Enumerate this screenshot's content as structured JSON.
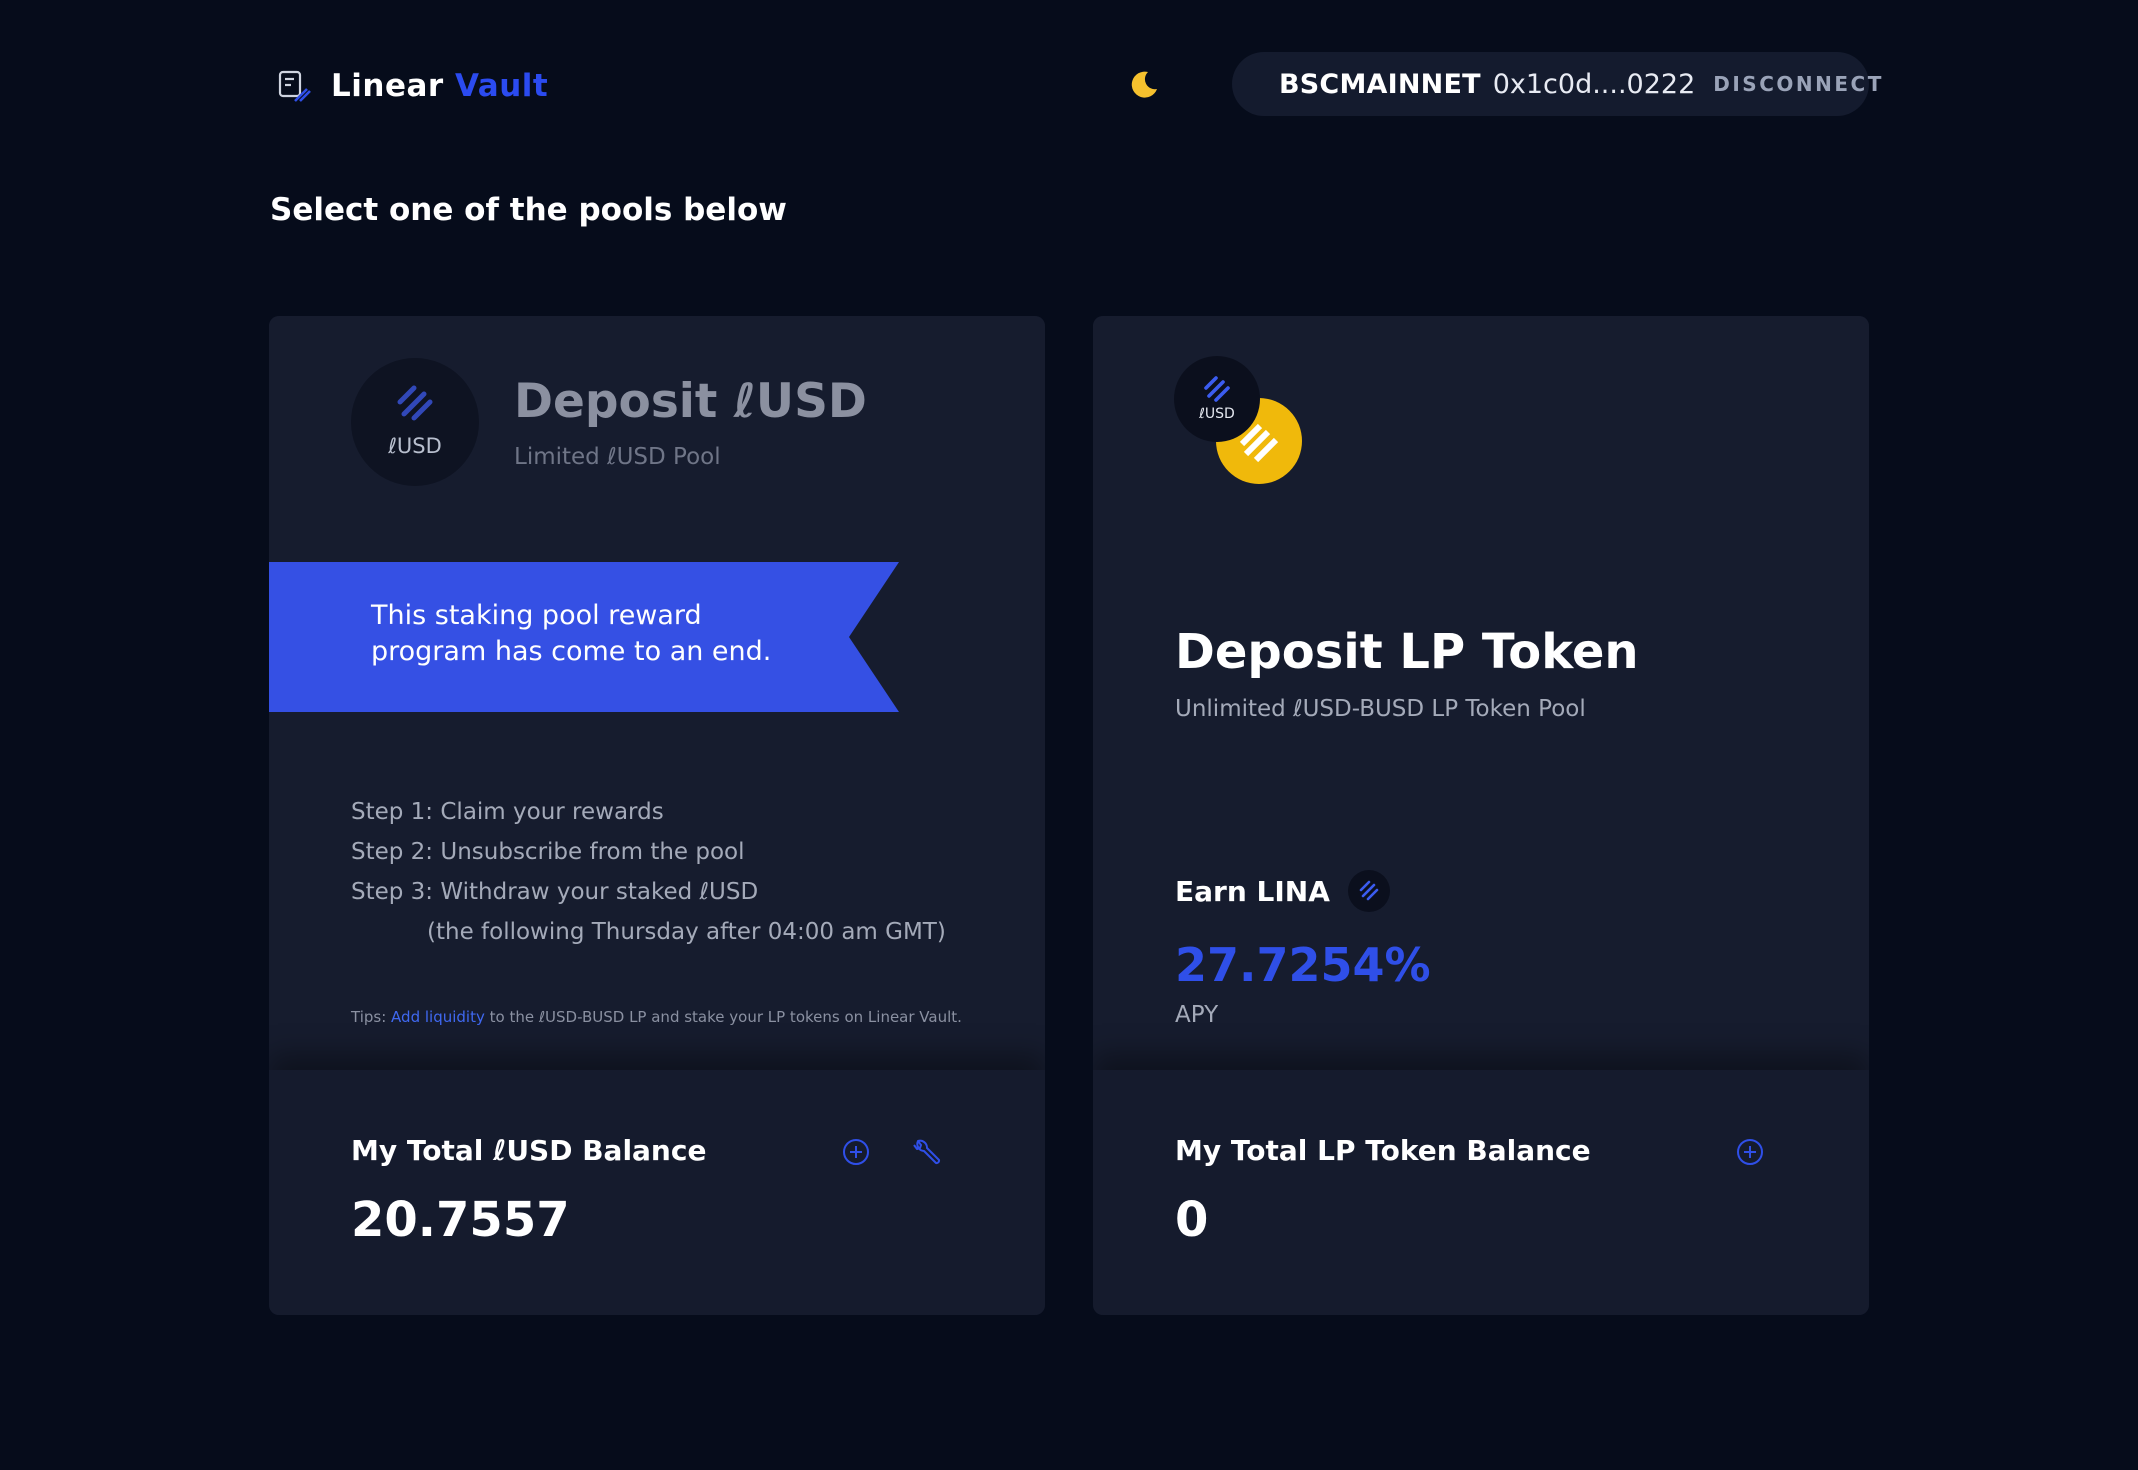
{
  "header": {
    "logo_word_1": "Linear",
    "logo_word_2": "Vault",
    "network": "BSCMAINNET",
    "address": "0x1c0d....0222",
    "disconnect_label": "DISCONNECT"
  },
  "page_title": "Select one of the pools below",
  "left_card": {
    "coin_label": "ℓUSD",
    "title": "Deposit ℓUSD",
    "subtitle": "Limited ℓUSD Pool",
    "ribbon_text": "This staking pool reward program has come to an end.",
    "steps": [
      "Step 1: Claim your rewards",
      "Step 2: Unsubscribe from the pool",
      "Step 3: Withdraw your staked ℓUSD",
      "(the following Thursday after 04:00 am GMT)"
    ],
    "tips_prefix": "Tips:",
    "tips_link": "Add liquidity",
    "tips_suffix": "to the ℓUSD-BUSD LP and stake your LP tokens on Linear Vault.",
    "balance_title": "My Total ℓUSD Balance",
    "balance_value": "20.7557"
  },
  "right_card": {
    "coin_label": "ℓUSD",
    "title": "Deposit LP Token",
    "subtitle": "Unlimited ℓUSD-BUSD LP Token Pool",
    "earn_label": "Earn LINA",
    "apy_value": "27.7254%",
    "apy_label": "APY",
    "balance_title": "My Total LP Token Balance",
    "balance_value": "0"
  },
  "colors": {
    "background": "#060c1b",
    "card": "#161c2e",
    "accent_blue": "#2f4fe8",
    "ribbon": "#3550e4",
    "moon_yellow": "#f5c12e",
    "busd_yellow": "#f0b90b"
  },
  "icons": [
    "linear-vault-logo-icon",
    "moon-icon",
    "bnb-icon",
    "lusd-coin-icon",
    "busd-coin-icon",
    "lina-coin-icon",
    "plus-circle-icon",
    "wrench-icon"
  ]
}
